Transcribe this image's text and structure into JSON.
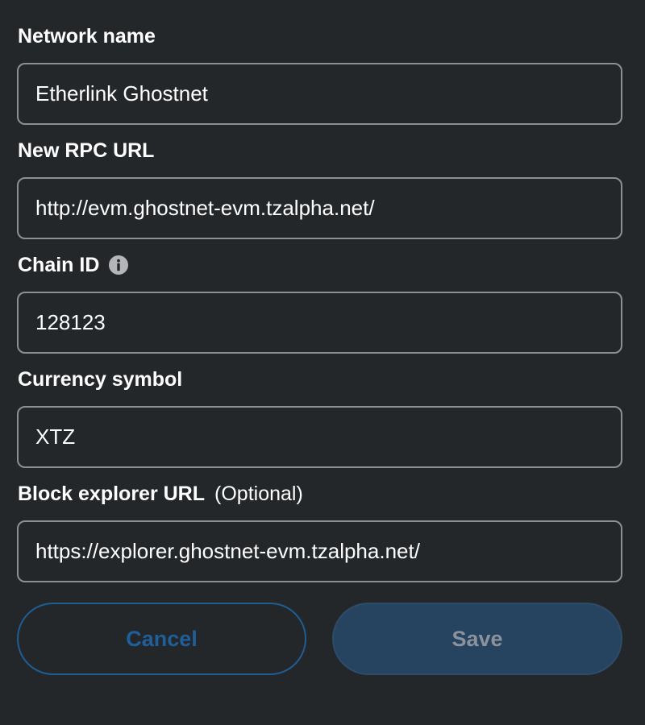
{
  "form": {
    "network_name": {
      "label": "Network name",
      "value": "Etherlink Ghostnet"
    },
    "rpc_url": {
      "label": "New RPC URL",
      "value": "http://evm.ghostnet-evm.tzalpha.net/"
    },
    "chain_id": {
      "label": "Chain ID",
      "info_icon": "info-circle-icon",
      "value": "128123"
    },
    "currency_symbol": {
      "label": "Currency symbol",
      "value": "XTZ"
    },
    "block_explorer": {
      "label": "Block explorer URL",
      "optional_text": "(Optional)",
      "value": "https://explorer.ghostnet-evm.tzalpha.net/"
    }
  },
  "actions": {
    "cancel_label": "Cancel",
    "save_label": "Save"
  },
  "colors": {
    "background": "#24272a",
    "field_border": "#8d8f93",
    "primary": "#1f5d93",
    "primary_disabled_bg": "#26435f",
    "disabled_text": "#8b929b"
  }
}
